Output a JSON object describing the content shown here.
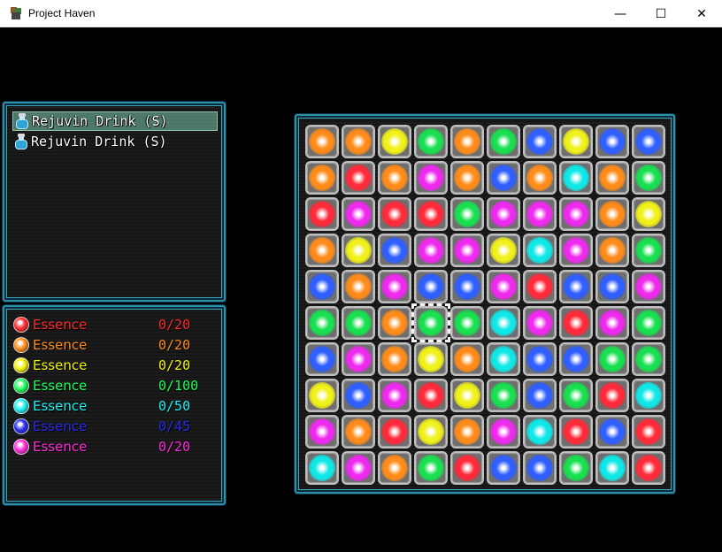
{
  "window": {
    "title": "Project Haven",
    "controls": {
      "minimize": "—",
      "maximize": "☐",
      "close": "✕"
    }
  },
  "items": [
    {
      "label": "Rejuvin Drink (S)",
      "selected": true
    },
    {
      "label": "Rejuvin Drink (S)",
      "selected": false
    }
  ],
  "essences": [
    {
      "label": "Essence",
      "count": "0/20",
      "color": "#ff2a2a"
    },
    {
      "label": "Essence",
      "count": "0/20",
      "color": "#ff8c1a"
    },
    {
      "label": "Essence",
      "count": "0/20",
      "color": "#f2f20a"
    },
    {
      "label": "Essence",
      "count": "0/100",
      "color": "#1aff5a"
    },
    {
      "label": "Essence",
      "count": "0/50",
      "color": "#1af2f2"
    },
    {
      "label": "Essence",
      "count": "0/45",
      "color": "#2a2aee"
    },
    {
      "label": "Essence",
      "count": "0/20",
      "color": "#ff2ad9"
    }
  ],
  "gem_colors": {
    "O": "#ff8c1a",
    "Y": "#f0f01a",
    "G": "#18e050",
    "B": "#2f5fff",
    "R": "#ff2a3a",
    "M": "#ee2aee",
    "C": "#10e8e8"
  },
  "board": {
    "rows": [
      [
        "O",
        "O",
        "Y",
        "G",
        "O",
        "G",
        "B",
        "Y",
        "B",
        "B"
      ],
      [
        "O",
        "R",
        "O",
        "M",
        "O",
        "B",
        "O",
        "C",
        "O",
        "G"
      ],
      [
        "R",
        "M",
        "R",
        "R",
        "G",
        "M",
        "M",
        "M",
        "O",
        "Y"
      ],
      [
        "O",
        "Y",
        "B",
        "M",
        "M",
        "Y",
        "C",
        "M",
        "O",
        "G"
      ],
      [
        "B",
        "O",
        "M",
        "B",
        "B",
        "M",
        "R",
        "B",
        "B",
        "M"
      ],
      [
        "G",
        "G",
        "O",
        "G",
        "G",
        "C",
        "M",
        "R",
        "M",
        "G"
      ],
      [
        "B",
        "M",
        "O",
        "Y",
        "O",
        "C",
        "B",
        "B",
        "G",
        "G"
      ],
      [
        "Y",
        "B",
        "M",
        "R",
        "Y",
        "G",
        "B",
        "G",
        "R",
        "C"
      ],
      [
        "M",
        "O",
        "R",
        "Y",
        "O",
        "M",
        "C",
        "R",
        "B",
        "R"
      ],
      [
        "C",
        "M",
        "O",
        "G",
        "R",
        "B",
        "B",
        "G",
        "C",
        "R"
      ]
    ],
    "cursor": {
      "row": 5,
      "col": 3
    }
  }
}
